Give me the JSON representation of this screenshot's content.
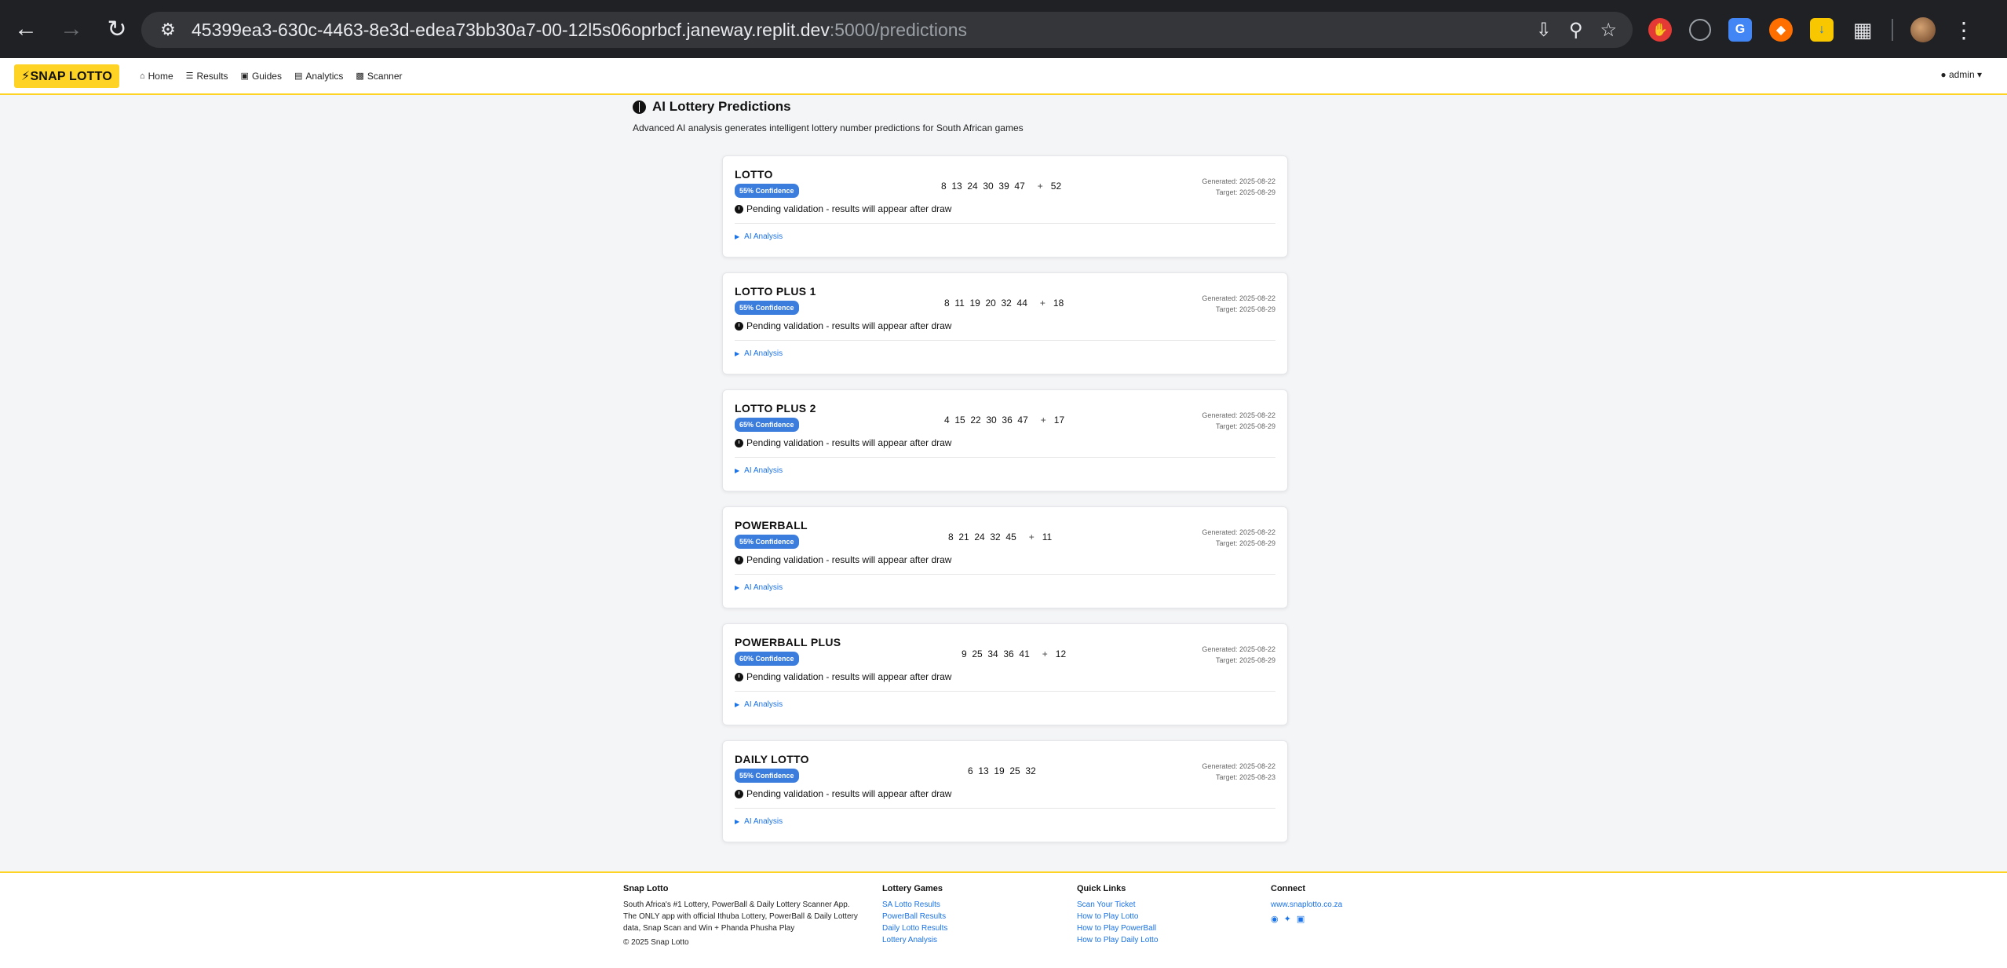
{
  "browser": {
    "url_host": "45399ea3-630c-4463-8e3d-edea73bb30a7-00-12l5s06oprbcf.janeway.replit.dev",
    "url_path": ":5000/predictions"
  },
  "navbar": {
    "brand": "SNAP LOTTO",
    "links": [
      {
        "label": "Home",
        "icon": "home-icon"
      },
      {
        "label": "Results",
        "icon": "list-icon"
      },
      {
        "label": "Guides",
        "icon": "book-icon"
      },
      {
        "label": "Analytics",
        "icon": "chart-icon"
      },
      {
        "label": "Scanner",
        "icon": "camera-icon"
      }
    ],
    "user": "admin"
  },
  "page": {
    "title": "AI Lottery Predictions",
    "subtitle": "Advanced AI analysis generates intelligent lottery number predictions for South African games"
  },
  "predictions": [
    {
      "name": "LOTTO",
      "confidence": "55% Confidence",
      "status": "Pending validation - results will appear after draw",
      "numbers": "8  13  24  30  39  47",
      "bonus": "52",
      "generated": "Generated: 2025-08-22",
      "target": "Target: 2025-08-29",
      "analysis": "AI Analysis"
    },
    {
      "name": "LOTTO PLUS 1",
      "confidence": "55% Confidence",
      "status": "Pending validation - results will appear after draw",
      "numbers": "8  11  19  20  32  44",
      "bonus": "18",
      "generated": "Generated: 2025-08-22",
      "target": "Target: 2025-08-29",
      "analysis": "AI Analysis"
    },
    {
      "name": "LOTTO PLUS 2",
      "confidence": "65% Confidence",
      "status": "Pending validation - results will appear after draw",
      "numbers": "4  15  22  30  36  47",
      "bonus": "17",
      "generated": "Generated: 2025-08-22",
      "target": "Target: 2025-08-29",
      "analysis": "AI Analysis"
    },
    {
      "name": "POWERBALL",
      "confidence": "55% Confidence",
      "status": "Pending validation - results will appear after draw",
      "numbers": "8  21  24  32  45",
      "bonus": "11",
      "generated": "Generated: 2025-08-22",
      "target": "Target: 2025-08-29",
      "analysis": "AI Analysis"
    },
    {
      "name": "POWERBALL PLUS",
      "confidence": "60% Confidence",
      "status": "Pending validation - results will appear after draw",
      "numbers": "9  25  34  36  41",
      "bonus": "12",
      "generated": "Generated: 2025-08-22",
      "target": "Target: 2025-08-29",
      "analysis": "AI Analysis"
    },
    {
      "name": "DAILY LOTTO",
      "confidence": "55% Confidence",
      "status": "Pending validation - results will appear after draw",
      "numbers": "6  13  19  25  32",
      "bonus": "",
      "generated": "Generated: 2025-08-22",
      "target": "Target: 2025-08-23",
      "analysis": "AI Analysis"
    }
  ],
  "footer": {
    "about": {
      "heading": "Snap Lotto",
      "text": "South Africa's #1 Lottery, PowerBall & Daily Lottery Scanner App. The ONLY app with official Ithuba Lottery, PowerBall & Daily Lottery data, Snap Scan and Win + Phanda Phusha Play",
      "copyright": "© 2025 Snap Lotto"
    },
    "games": {
      "heading": "Lottery Games",
      "links": [
        "SA Lotto Results",
        "PowerBall Results",
        "Daily Lotto Results",
        "Lottery Analysis"
      ]
    },
    "quick": {
      "heading": "Quick Links",
      "links": [
        "Scan Your Ticket",
        "How to Play Lotto",
        "How to Play PowerBall",
        "How to Play Daily Lotto"
      ]
    },
    "connect": {
      "heading": "Connect",
      "website": "www.snaplotto.co.za"
    }
  }
}
